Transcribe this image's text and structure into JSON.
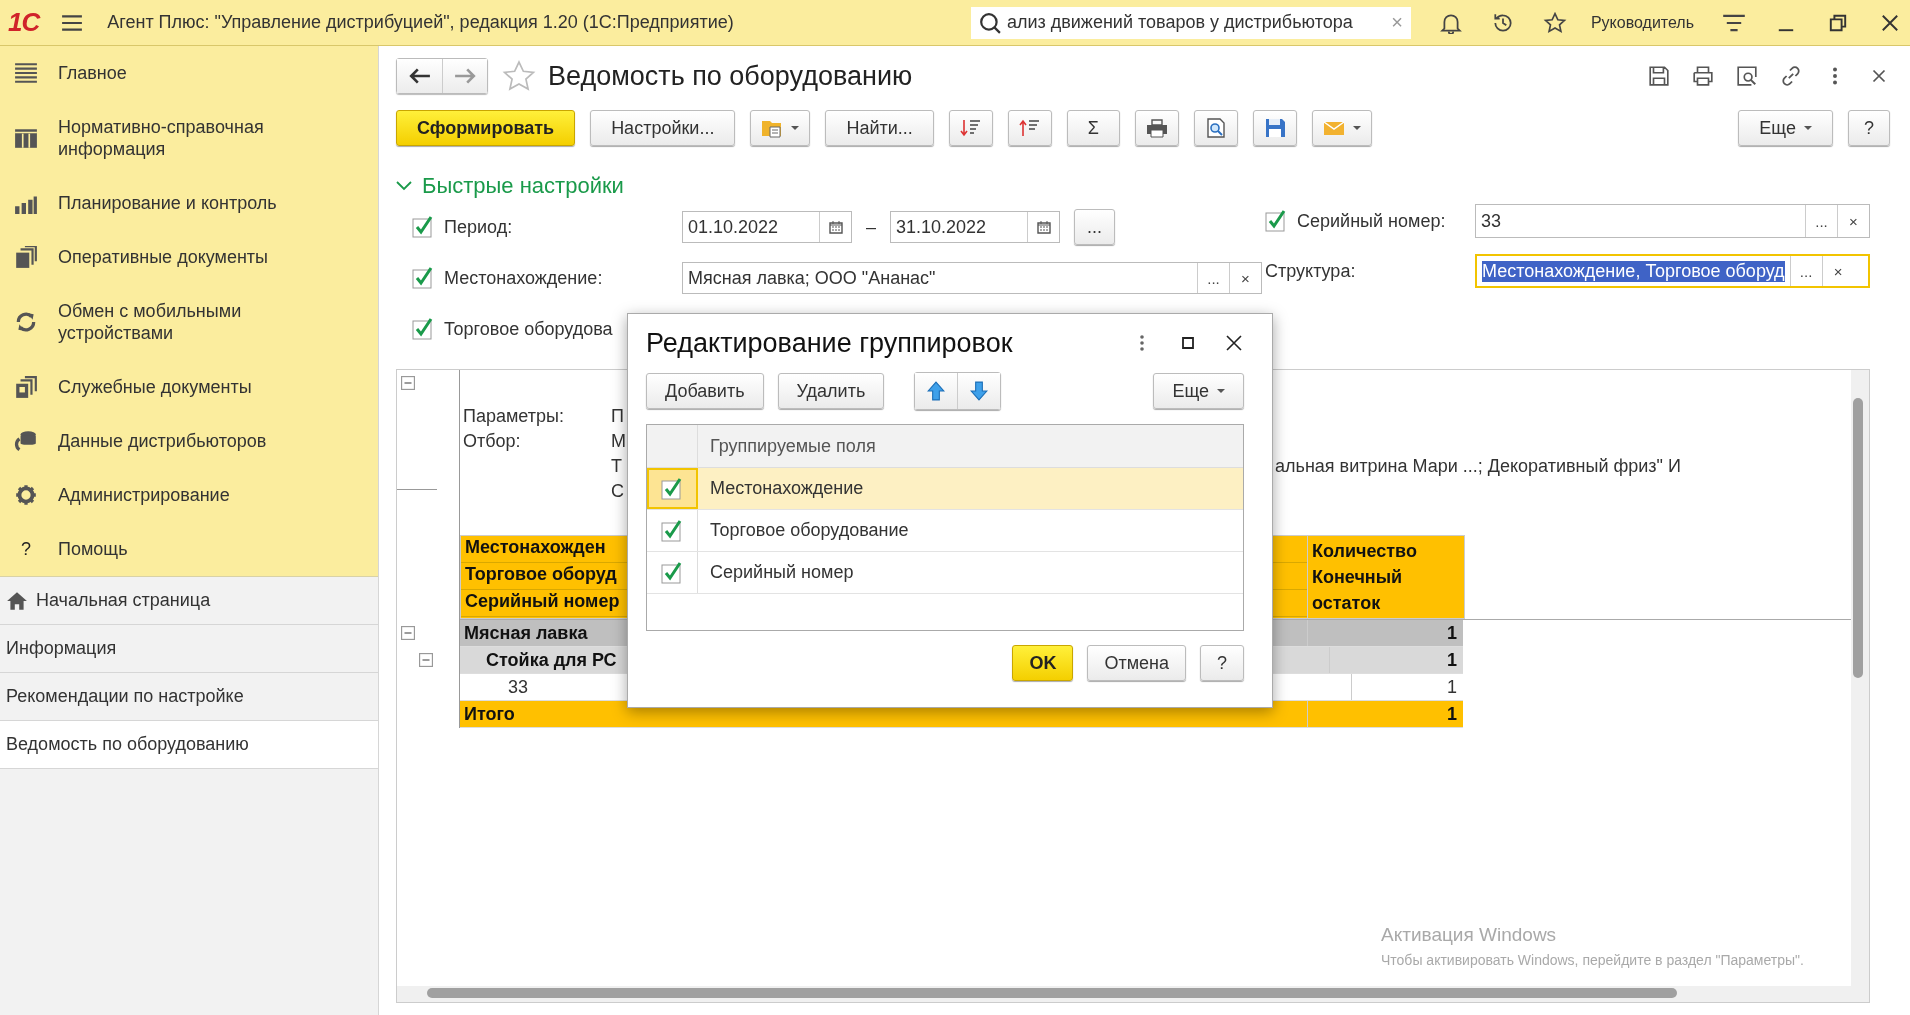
{
  "app_bar": {
    "logo": "1С",
    "title": "Агент Плюс: \"Управление дистрибуцией\", редакция 1.20  (1С:Предприятие)",
    "search": {
      "value": "ализ движений товаров у дистрибьютора",
      "clear": "×"
    },
    "user": "Руководитель"
  },
  "sidebar": {
    "sections": [
      {
        "label": "Главное",
        "kind": "menu"
      },
      {
        "label": "Нормативно-справочная информация",
        "kind": "catalog"
      },
      {
        "label": "Планирование и контроль",
        "kind": "chart"
      },
      {
        "label": "Оперативные документы",
        "kind": "docs"
      },
      {
        "label": "Обмен с мобильными устройствами",
        "kind": "sync"
      },
      {
        "label": "Служебные документы",
        "kind": "service"
      },
      {
        "label": "Данные дистрибьюторов",
        "kind": "distributors"
      },
      {
        "label": "Администрирование",
        "kind": "gear"
      },
      {
        "label": "Помощь",
        "kind": "glyph",
        "glyph": "?"
      }
    ],
    "windows": [
      {
        "label": "Начальная страница",
        "home": true,
        "selected": false
      },
      {
        "label": "Информация",
        "home": false,
        "selected": false
      },
      {
        "label": "Рекомендации по настройке",
        "home": false,
        "selected": false
      },
      {
        "label": "Ведомость по оборудованию",
        "home": false,
        "selected": true
      }
    ]
  },
  "form": {
    "title": "Ведомость по оборудованию",
    "toolbar": [
      {
        "kind": "primary",
        "label": "Сформировать"
      },
      {
        "kind": "button",
        "label": "Настройки..."
      },
      {
        "kind": "variant"
      },
      {
        "kind": "button",
        "label": "Найти..."
      },
      {
        "kind": "sort_desc"
      },
      {
        "kind": "sort_asc"
      },
      {
        "kind": "button",
        "label": "Σ"
      },
      {
        "kind": "print"
      },
      {
        "kind": "preview"
      },
      {
        "kind": "save"
      },
      {
        "kind": "mail"
      }
    ],
    "toolbar_right": [
      {
        "kind": "menu",
        "label": "Еще"
      },
      {
        "kind": "button",
        "label": "?"
      }
    ],
    "quick_settings": {
      "title": "Быстрые настройки",
      "expanded": true,
      "left": [
        {
          "kind": "period",
          "label": "Период:",
          "checked": true,
          "from": "01.10.2022",
          "dash": "–",
          "to": "31.10.2022",
          "more": "..."
        },
        {
          "kind": "field",
          "label": "Местонахождение:",
          "checked": true,
          "value": "Мясная лавка; ООО \"Ананас\"",
          "select": "...",
          "clear": "×"
        },
        {
          "kind": "label",
          "label": "Торговое оборудова",
          "checked": true
        }
      ],
      "right": [
        {
          "kind": "check_field",
          "label": "Серийный номер:",
          "checked": true,
          "value": "33",
          "focused": false,
          "select": "...",
          "clear": "×"
        },
        {
          "kind": "field",
          "label": "Структура:",
          "value": "Местонахождение, Торговое оборуд",
          "focused": true,
          "select": "...",
          "clear": "×"
        }
      ]
    }
  },
  "report": {
    "params": [
      {
        "label": "Параметры:",
        "value": "П"
      },
      {
        "label": "Отбор:",
        "value": "М"
      },
      {
        "value": "Т",
        "tail": "альная витрина Мари ...; Декоративный фриз\" И"
      },
      {
        "value": "С"
      }
    ],
    "header_left": [
      "Местонахожден",
      "Торговое оборуд",
      "Серийный номер"
    ],
    "header_right": "Количество Конечный остаток",
    "rows": [
      {
        "kind": "group1",
        "label": "Мясная лавка",
        "value": "1"
      },
      {
        "kind": "group2",
        "label": "Стойка для РС",
        "value": "1"
      },
      {
        "kind": "detail",
        "label": "33",
        "value": "1"
      },
      {
        "kind": "total",
        "label": "Итого",
        "value": "1"
      }
    ]
  },
  "dialog": {
    "title": "Редактирование группировок",
    "buttons": [
      "Добавить",
      "Удалить"
    ],
    "more": "Еще",
    "column": "Группируемые поля",
    "rows": [
      {
        "label": "Местонахождение",
        "checked": true,
        "selected": true
      },
      {
        "label": "Торговое оборудование",
        "checked": true,
        "selected": false
      },
      {
        "label": "Серийный номер",
        "checked": true,
        "selected": false
      }
    ],
    "footer": [
      {
        "kind": "primary",
        "label": "OK"
      },
      {
        "kind": "button",
        "label": "Отмена"
      },
      {
        "kind": "button",
        "label": "?"
      }
    ]
  },
  "os_notice": {
    "title": "Активация Windows",
    "text": "Чтобы активировать Windows, перейдите в раздел \"Параметры\"."
  }
}
